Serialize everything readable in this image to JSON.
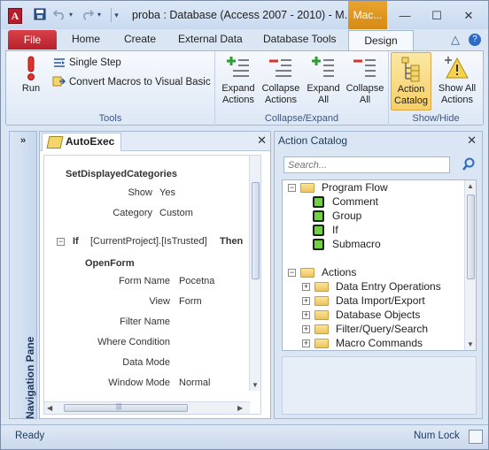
{
  "window": {
    "title": "proba : Database (Access 2007 - 2010)  -  M...",
    "app_icon": "A",
    "contextual_tab_head": "Mac...",
    "controls": {
      "minimize": "—",
      "maximize": "☐",
      "close": "✕"
    }
  },
  "qat": {
    "save_icon": "save-icon",
    "undo_icon": "undo-icon",
    "redo_icon": "redo-icon",
    "customize_icon": "dropdown-icon"
  },
  "tabs": {
    "file": "File",
    "items": [
      "Home",
      "Create",
      "External Data",
      "Database Tools"
    ],
    "active": "Design",
    "minimize_icon": "△",
    "help_icon": "?"
  },
  "ribbon": {
    "tools": {
      "label": "Tools",
      "run": "Run",
      "single_step": "Single Step",
      "convert": "Convert Macros to Visual Basic"
    },
    "collapse_expand": {
      "label": "Collapse/Expand",
      "expand_actions": [
        "Expand",
        "Actions"
      ],
      "collapse_actions": [
        "Collapse",
        "Actions"
      ],
      "expand_all": [
        "Expand",
        "All"
      ],
      "collapse_all": [
        "Collapse",
        "All"
      ]
    },
    "show_hide": {
      "label": "Show/Hide",
      "action_catalog": [
        "Action",
        "Catalog"
      ],
      "show_all_actions": [
        "Show All",
        "Actions"
      ]
    }
  },
  "nav_pane": {
    "label": "Navigation Pane",
    "chevron": "»"
  },
  "macro": {
    "tab_title": "AutoExec",
    "close": "✕",
    "action1": {
      "name": "SetDisplayedCategories",
      "args": [
        {
          "label": "Show",
          "value": "Yes"
        },
        {
          "label": "Category",
          "value": "Custom"
        }
      ]
    },
    "if_block": {
      "toggle": "−",
      "keyword": "If",
      "condition": "[CurrentProject].[IsTrusted]",
      "then": "Then"
    },
    "action2": {
      "name": "OpenForm",
      "args": [
        {
          "label": "Form Name",
          "value": "Pocetna"
        },
        {
          "label": "View",
          "value": "Form"
        },
        {
          "label": "Filter Name",
          "value": ""
        },
        {
          "label": "Where Condition",
          "value": ""
        },
        {
          "label": "Data Mode",
          "value": ""
        },
        {
          "label": "Window Mode",
          "value": "Normal"
        }
      ]
    },
    "hscroll_grip": "|||"
  },
  "catalog": {
    "title": "Action Catalog",
    "close": "✕",
    "search_placeholder": "Search...",
    "program_flow": {
      "label": "Program Flow",
      "toggle": "−",
      "items": [
        "Comment",
        "Group",
        "If",
        "Submacro"
      ]
    },
    "actions": {
      "label": "Actions",
      "toggle": "−",
      "items": [
        "Data Entry Operations",
        "Data Import/Export",
        "Database Objects",
        "Filter/Query/Search",
        "Macro Commands"
      ],
      "item_toggle": "+"
    }
  },
  "status": {
    "left": "Ready",
    "right": "Num Lock"
  },
  "colors": {
    "file_tab": "#c8252f",
    "contextual_tab": "#e09a22",
    "selected_button": "#f7cf65",
    "flow_item_icon": "#6ed33f"
  }
}
